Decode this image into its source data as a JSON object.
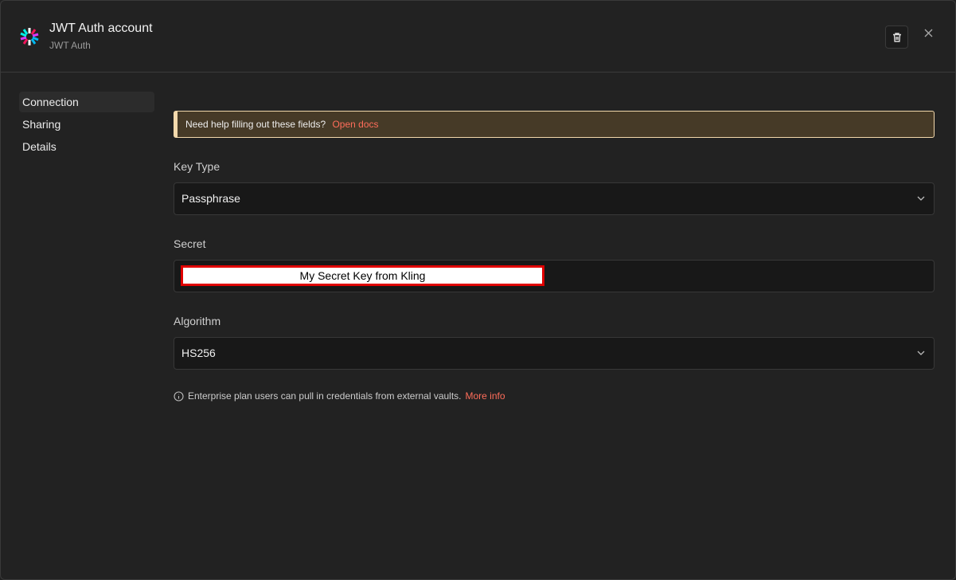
{
  "header": {
    "title": "JWT Auth account",
    "subtitle": "JWT Auth"
  },
  "nav": {
    "items": [
      {
        "label": "Connection"
      },
      {
        "label": "Sharing"
      },
      {
        "label": "Details"
      }
    ]
  },
  "banner": {
    "text": "Need help filling out these fields?",
    "link": "Open docs"
  },
  "fields": {
    "key_type": {
      "label": "Key Type",
      "value": "Passphrase"
    },
    "secret": {
      "label": "Secret",
      "value": "My Secret Key from Kling"
    },
    "algorithm": {
      "label": "Algorithm",
      "value": "HS256"
    }
  },
  "hint": {
    "text": "Enterprise plan users can pull in credentials from external vaults.",
    "link": "More info"
  },
  "colors": {
    "accent": "#ff6d5a",
    "banner_bg": "#463a27",
    "banner_border": "#f3d9ac"
  }
}
